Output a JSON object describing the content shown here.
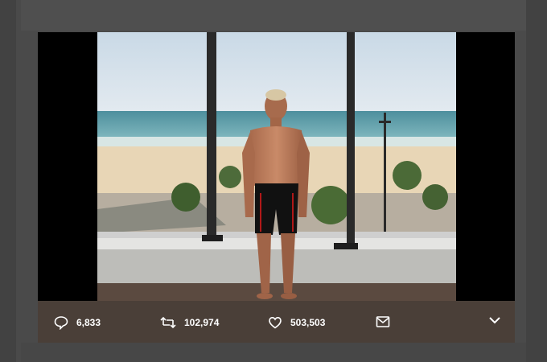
{
  "tweet_actions": {
    "replies": "6,833",
    "retweets": "102,974",
    "likes": "503,503"
  },
  "icons": {
    "reply": "speech-bubble-icon",
    "retweet": "retweet-icon",
    "like": "heart-icon",
    "message": "envelope-icon",
    "more": "chevron-down-icon"
  },
  "colors": {
    "action_bar": "#4a3f38",
    "overlay": "#000000",
    "icon": "#ffffff"
  }
}
